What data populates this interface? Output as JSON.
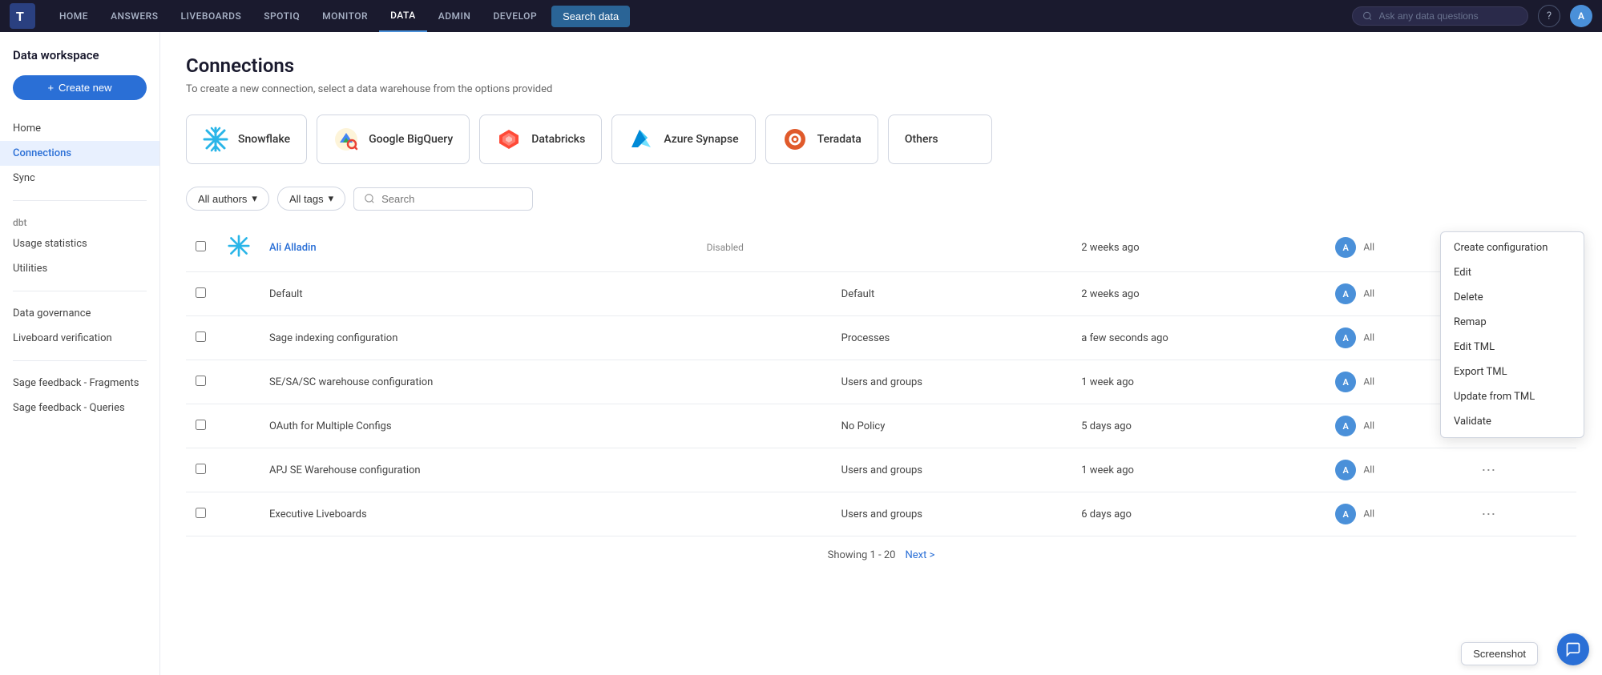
{
  "app": {
    "logo_text": "T",
    "nav_items": [
      {
        "label": "HOME",
        "active": false
      },
      {
        "label": "ANSWERS",
        "active": false
      },
      {
        "label": "LIVEBOARDS",
        "active": false
      },
      {
        "label": "SPOTIQ",
        "active": false
      },
      {
        "label": "MONITOR",
        "active": false
      },
      {
        "label": "DATA",
        "active": true
      },
      {
        "label": "ADMIN",
        "active": false
      },
      {
        "label": "DEVELOP",
        "active": false
      }
    ],
    "search_data_btn": "Search data",
    "ask_data_placeholder": "Ask any data questions",
    "help_label": "?",
    "avatar_label": "A"
  },
  "sidebar": {
    "title": "Data workspace",
    "create_btn_label": "Create new",
    "nav_items": [
      {
        "label": "Home",
        "active": false
      },
      {
        "label": "Connections",
        "active": true
      },
      {
        "label": "Sync",
        "active": false
      }
    ],
    "sections": [
      {
        "label": "dbt",
        "items": [
          {
            "label": "Usage statistics"
          },
          {
            "label": "Utilities"
          }
        ]
      }
    ],
    "extra_items": [
      {
        "label": "Data governance"
      },
      {
        "label": "Liveboard verification"
      }
    ],
    "feedback_items": [
      {
        "label": "Sage feedback - Fragments"
      },
      {
        "label": "Sage feedback - Queries"
      }
    ]
  },
  "main": {
    "page_title": "Connections",
    "page_subtitle": "To create a new connection, select a data warehouse from the options provided",
    "connection_types": [
      {
        "name": "Snowflake",
        "icon": "snowflake"
      },
      {
        "name": "Google BigQuery",
        "icon": "bigquery"
      },
      {
        "name": "Databricks",
        "icon": "databricks"
      },
      {
        "name": "Azure Synapse",
        "icon": "azure"
      },
      {
        "name": "Teradata",
        "icon": "teradata"
      },
      {
        "name": "Others",
        "icon": "others"
      }
    ],
    "filters": {
      "authors_label": "All authors",
      "tags_label": "All tags",
      "search_placeholder": "Search"
    },
    "table": {
      "rows": [
        {
          "name": "Ali Alladin",
          "is_link": true,
          "status": "Disabled",
          "policy": "",
          "modified": "2 weeks ago",
          "avatar": "A",
          "access": "All",
          "has_menu": true,
          "menu_open": true
        },
        {
          "name": "Default",
          "is_link": false,
          "status": "",
          "policy": "Default",
          "modified": "2 weeks ago",
          "avatar": "A",
          "access": "All",
          "has_menu": false
        },
        {
          "name": "Sage indexing configuration",
          "is_link": false,
          "status": "",
          "policy": "Processes",
          "modified": "a few seconds ago",
          "avatar": "A",
          "access": "All",
          "has_menu": false
        },
        {
          "name": "SE/SA/SC warehouse configuration",
          "is_link": false,
          "status": "",
          "policy": "Users and groups",
          "modified": "1 week ago",
          "avatar": "A",
          "access": "All",
          "has_menu": false
        },
        {
          "name": "OAuth for Multiple Configs",
          "is_link": false,
          "status": "",
          "policy": "No Policy",
          "modified": "5 days ago",
          "avatar": "A",
          "access": "All",
          "has_menu": false
        },
        {
          "name": "APJ SE Warehouse configuration",
          "is_link": false,
          "status": "",
          "policy": "Users and groups",
          "modified": "1 week ago",
          "avatar": "A",
          "access": "All",
          "has_menu": true,
          "menu_open": false
        },
        {
          "name": "Executive Liveboards",
          "is_link": false,
          "status": "",
          "policy": "Users and groups",
          "modified": "6 days ago",
          "avatar": "A",
          "access": "All",
          "has_menu": true,
          "menu_open": false
        }
      ]
    },
    "pagination": {
      "label": "Showing  1 - 20",
      "next_label": "Next >"
    },
    "context_menu": {
      "items": [
        "Create configuration",
        "Edit",
        "Delete",
        "Remap",
        "Edit TML",
        "Export TML",
        "Update from TML",
        "Validate"
      ]
    },
    "screenshot_btn": "Screenshot"
  }
}
